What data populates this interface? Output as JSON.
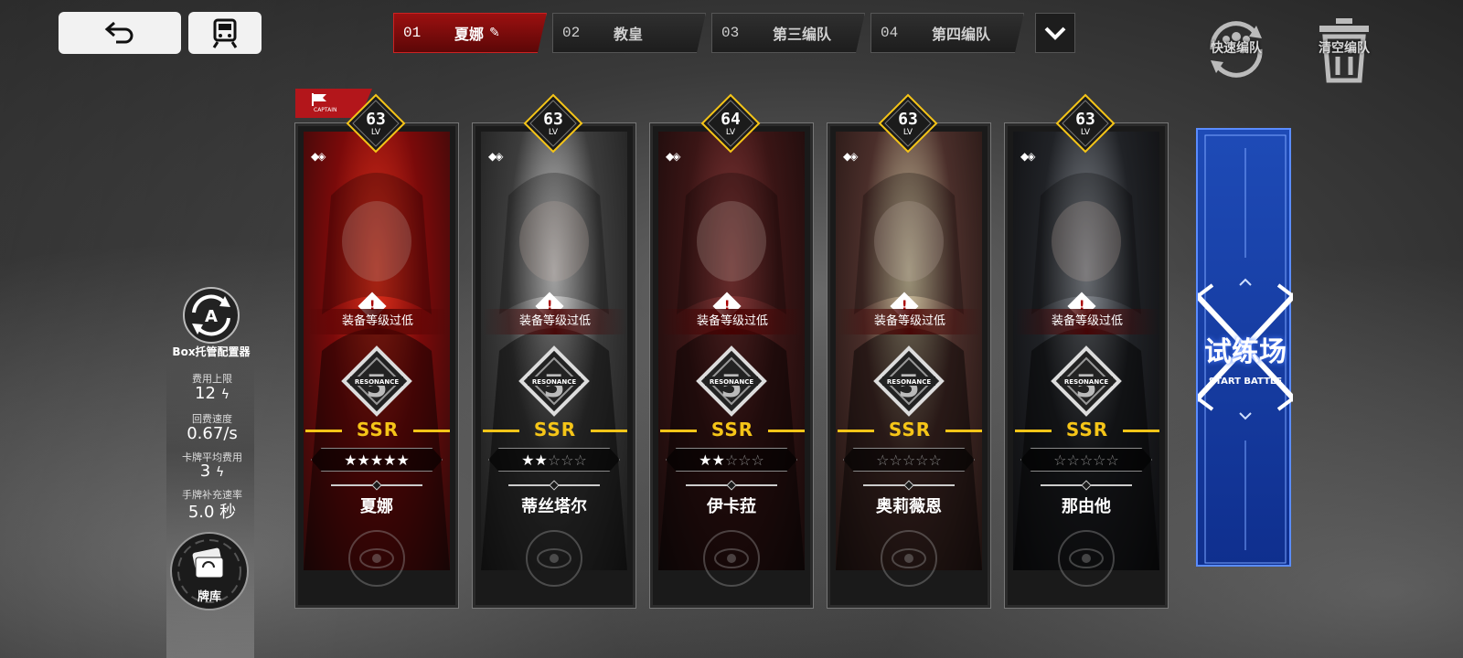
{
  "nav": {
    "back_icon": "undo-arrow-icon",
    "home_icon": "train-icon"
  },
  "tabs": [
    {
      "num": "01",
      "name": "夏娜",
      "active": true
    },
    {
      "num": "02",
      "name": "教皇",
      "active": false
    },
    {
      "num": "03",
      "name": "第三编队",
      "active": false
    },
    {
      "num": "04",
      "name": "第四编队",
      "active": false
    }
  ],
  "actions": {
    "quick_team": "快速编队",
    "clear_team": "清空编队"
  },
  "left_panel": {
    "box_label": "Box托管配置器",
    "cost_cap_label": "费用上限",
    "cost_cap_value": "12",
    "regen_label": "回费速度",
    "regen_value": "0.67/s",
    "avg_cost_label": "卡牌平均费用",
    "avg_cost_value": "3",
    "refill_label": "手牌补充速率",
    "refill_value": "5.0 秒",
    "deck_label": "牌库"
  },
  "captain_label": "CAPTAIN",
  "cards": [
    {
      "name": "夏娜",
      "level": "63",
      "lv": "LV",
      "warning": "装备等级过低",
      "resonance": "RESONANCE",
      "rarity": "SSR",
      "stars": 5
    },
    {
      "name": "蒂丝塔尔",
      "level": "63",
      "lv": "LV",
      "warning": "装备等级过低",
      "resonance": "RESONANCE",
      "rarity": "SSR",
      "stars": 2
    },
    {
      "name": "伊卡菈",
      "level": "64",
      "lv": "LV",
      "warning": "装备等级过低",
      "resonance": "RESONANCE",
      "rarity": "SSR",
      "stars": 2
    },
    {
      "name": "奥莉薇恩",
      "level": "63",
      "lv": "LV",
      "warning": "装备等级过低",
      "resonance": "RESONANCE",
      "rarity": "SSR",
      "stars": 0
    },
    {
      "name": "那由他",
      "level": "63",
      "lv": "LV",
      "warning": "装备等级过低",
      "resonance": "RESONANCE",
      "rarity": "SSR",
      "stars": 0
    }
  ],
  "battle": {
    "title": "试练场",
    "subtitle": "START BATTLE"
  },
  "colors": {
    "accent_red": "#9b1010",
    "rarity_gold": "#f5c518",
    "battle_blue": "#1e4bb7"
  }
}
